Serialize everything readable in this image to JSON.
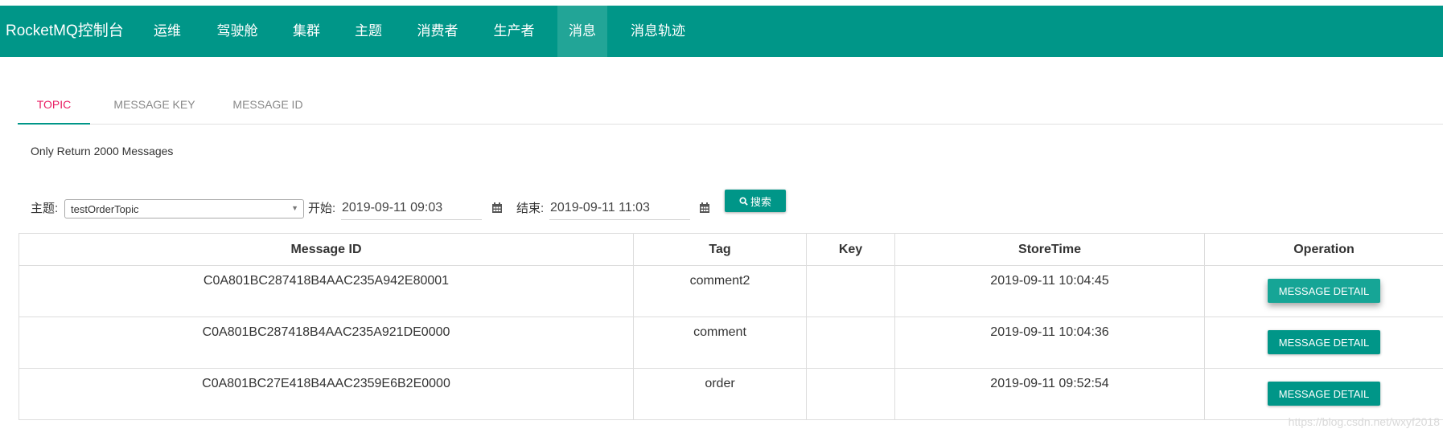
{
  "header": {
    "brand": "RocketMQ控制台",
    "nav": [
      "运维",
      "驾驶舱",
      "集群",
      "主题",
      "消费者",
      "生产者",
      "消息",
      "消息轨迹"
    ],
    "active_nav": "消息",
    "color": "#009688"
  },
  "tabs": [
    "TOPIC",
    "MESSAGE KEY",
    "MESSAGE ID"
  ],
  "active_tab": "TOPIC",
  "notice": "Only Return 2000 Messages",
  "search": {
    "topic_label": "主题:",
    "topic_value": "testOrderTopic",
    "start_label": "开始:",
    "start_value": "2019-09-11 09:03",
    "end_label": "结束:",
    "end_value": "2019-09-11 11:03",
    "button_label": "搜索",
    "button_icon": "search-icon"
  },
  "table": {
    "headers": [
      "Message ID",
      "Tag",
      "Key",
      "StoreTime",
      "Operation"
    ],
    "rows": [
      {
        "id": "C0A801BC287418B4AAC235A942E80001",
        "tag": "comment2",
        "key": "",
        "store_time": "2019-09-11 10:04:45",
        "op": "MESSAGE DETAIL"
      },
      {
        "id": "C0A801BC287418B4AAC235A921DE0000",
        "tag": "comment",
        "key": "",
        "store_time": "2019-09-11 10:04:36",
        "op": "MESSAGE DETAIL"
      },
      {
        "id": "C0A801BC27E418B4AAC2359E6B2E0000",
        "tag": "order",
        "key": "",
        "store_time": "2019-09-11 09:52:54",
        "op": "MESSAGE DETAIL"
      }
    ]
  },
  "watermark": "https://blog.csdn.net/wxyf2018"
}
